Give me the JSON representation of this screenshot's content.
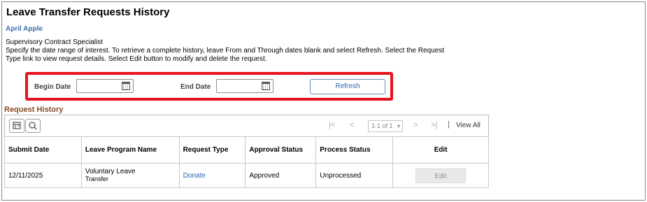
{
  "page": {
    "title": "Leave Transfer Requests History",
    "employee_name": "April Apple",
    "job_title": "Supervisory Contract Specialist",
    "instructions": "Specify the date range of interest. To retrieve a complete history, leave From and Through dates blank and select Refresh. Select the Request Type link to view request details. Select Edit button to modify and delete the request."
  },
  "filters": {
    "begin_date_label": "Begin Date",
    "begin_date_value": "",
    "end_date_label": "End Date",
    "end_date_value": "",
    "refresh_label": "Refresh",
    "highlight_color": "#e8141c"
  },
  "request_history": {
    "section_title": "Request History",
    "toolbar": {
      "pager_label": "1-1 of 1",
      "view_all_label": "View All"
    },
    "columns": [
      "Submit Date",
      "Leave Program Name",
      "Request Type",
      "Approval Status",
      "Process Status",
      "Edit"
    ],
    "rows": [
      {
        "submit_date": "12/11/2025",
        "leave_program_line1": "Voluntary Leave",
        "leave_program_line2": "Transfer",
        "request_type": "Donate",
        "approval_status": "Approved",
        "process_status": "Unprocessed",
        "edit_label": "Edit"
      }
    ]
  },
  "icons": {
    "calendar": "calendar-icon",
    "grid_personalize": "grid-personalize-icon",
    "search": "search-icon",
    "first": "first-page-icon",
    "previous": "previous-page-icon",
    "next": "next-page-icon",
    "last": "last-page-icon"
  }
}
